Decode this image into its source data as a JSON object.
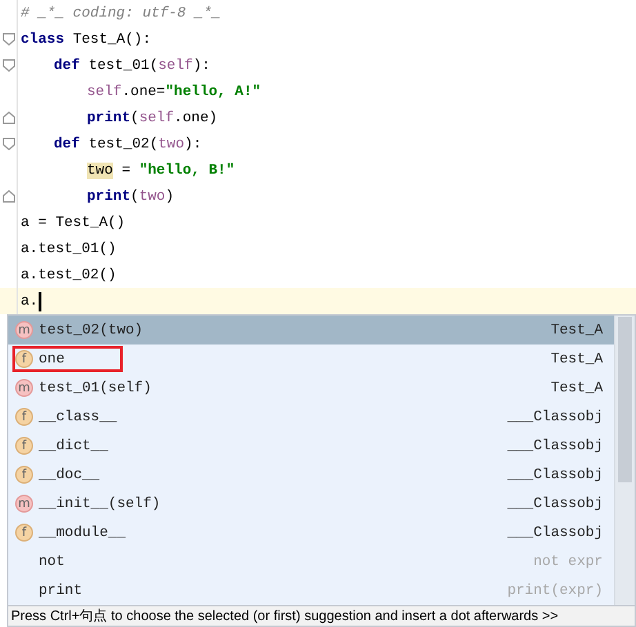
{
  "editor": {
    "lines": [
      {
        "fold_start": false,
        "fold_end": false,
        "tokens": [
          {
            "kind": "comment",
            "text": "# _*_ coding: utf-8 _*_"
          }
        ]
      },
      {
        "fold_start": true,
        "fold_end": false,
        "tokens": [
          {
            "kind": "keyword",
            "text": "class"
          },
          {
            "kind": "plain",
            "text": " Test_A():"
          }
        ],
        "children": [
          {
            "fold_start": true,
            "fold_end": false,
            "tokens": [
              {
                "kind": "keyword",
                "text": "def"
              },
              {
                "kind": "plain",
                "text": " test_01("
              },
              {
                "kind": "self",
                "text": "self"
              },
              {
                "kind": "plain",
                "text": "):"
              }
            ],
            "children": [
              {
                "fold_start": false,
                "fold_end": false,
                "tokens": [
                  {
                    "kind": "self",
                    "text": "self"
                  },
                  {
                    "kind": "plain",
                    "text": ".one="
                  },
                  {
                    "kind": "string",
                    "text": "\"hello, A!\""
                  }
                ]
              },
              {
                "fold_start": false,
                "fold_end": true,
                "tokens": [
                  {
                    "kind": "keyword",
                    "text": "print"
                  },
                  {
                    "kind": "plain",
                    "text": "("
                  },
                  {
                    "kind": "self",
                    "text": "self"
                  },
                  {
                    "kind": "plain",
                    "text": ".one)"
                  }
                ]
              }
            ]
          },
          {
            "fold_start": true,
            "fold_end": false,
            "tokens": [
              {
                "kind": "keyword",
                "text": "def"
              },
              {
                "kind": "plain",
                "text": " test_02("
              },
              {
                "kind": "self",
                "text": "two"
              },
              {
                "kind": "plain",
                "text": "):"
              }
            ],
            "children": [
              {
                "fold_start": false,
                "fold_end": false,
                "tokens": [
                  {
                    "kind": "marked",
                    "text": "two"
                  },
                  {
                    "kind": "plain",
                    "text": " = "
                  },
                  {
                    "kind": "string",
                    "text": "\"hello, B!\""
                  }
                ]
              },
              {
                "fold_start": false,
                "fold_end": true,
                "tokens": [
                  {
                    "kind": "keyword",
                    "text": "print"
                  },
                  {
                    "kind": "plain",
                    "text": "("
                  },
                  {
                    "kind": "self",
                    "text": "two"
                  },
                  {
                    "kind": "plain",
                    "text": ")"
                  }
                ]
              }
            ]
          }
        ]
      },
      {
        "fold_start": false,
        "fold_end": false,
        "tokens": [
          {
            "kind": "plain",
            "text": "a = Test_A()"
          }
        ]
      },
      {
        "fold_start": false,
        "fold_end": false,
        "tokens": [
          {
            "kind": "plain",
            "text": "a.test_01()"
          }
        ]
      },
      {
        "fold_start": false,
        "fold_end": false,
        "tokens": [
          {
            "kind": "plain",
            "text": "a.test_02()"
          }
        ]
      },
      {
        "fold_start": false,
        "fold_end": false,
        "current": true,
        "tokens": [
          {
            "kind": "plain",
            "text": "a."
          }
        ]
      }
    ]
  },
  "completion": {
    "items": [
      {
        "kind": "method",
        "icon": "m",
        "name": "test_02(two)",
        "type": "Test_A",
        "selected": true,
        "outlined": false
      },
      {
        "kind": "field",
        "icon": "f",
        "name": "one",
        "type": "Test_A",
        "selected": false,
        "outlined": true
      },
      {
        "kind": "method",
        "icon": "m",
        "name": "test_01(self)",
        "type": "Test_A",
        "selected": false,
        "outlined": false
      },
      {
        "kind": "field",
        "icon": "f",
        "name": "__class__",
        "type": "___Classobj",
        "selected": false,
        "outlined": false
      },
      {
        "kind": "field",
        "icon": "f",
        "name": "__dict__",
        "type": "___Classobj",
        "selected": false,
        "outlined": false
      },
      {
        "kind": "field",
        "icon": "f",
        "name": "__doc__",
        "type": "___Classobj",
        "selected": false,
        "outlined": false
      },
      {
        "kind": "method",
        "icon": "m",
        "name": "__init__(self)",
        "type": "___Classobj",
        "selected": false,
        "outlined": false
      },
      {
        "kind": "field",
        "icon": "f",
        "name": "__module__",
        "type": "___Classobj",
        "selected": false,
        "outlined": false
      },
      {
        "kind": "template",
        "name": "not",
        "type": "not expr",
        "selected": false,
        "outlined": false
      },
      {
        "kind": "template",
        "name": "print",
        "type": "print(expr)",
        "selected": false,
        "outlined": false
      }
    ],
    "hint": "Press Ctrl+句点 to choose the selected (or first) suggestion and insert a dot afterwards >>"
  }
}
